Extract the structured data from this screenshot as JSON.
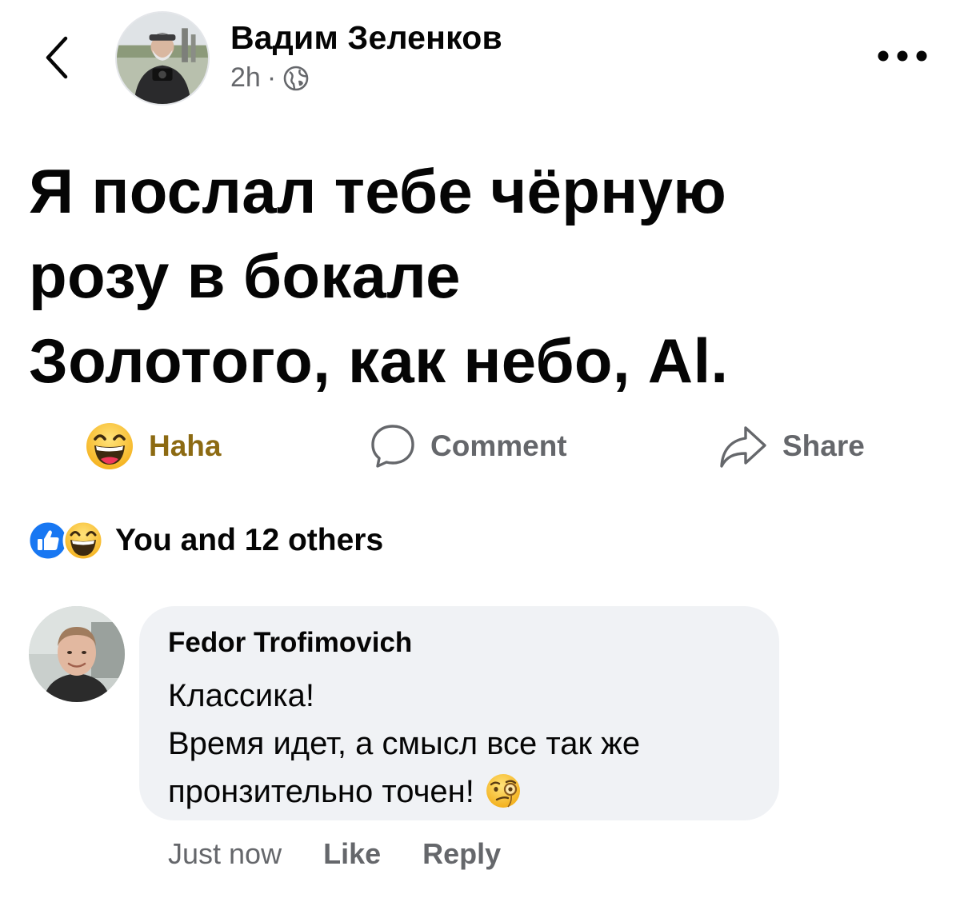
{
  "header": {
    "back_icon": "chevron-left-icon",
    "author_name": "Вадим Зеленков",
    "timestamp": "2h",
    "separator": "·",
    "audience_icon": "globe-icon",
    "more_icon": "more-horizontal-icon"
  },
  "post": {
    "lines": [
      "Я послал тебе чёрную",
      "розу в бокале",
      "Золотого, как небо, Аl."
    ]
  },
  "actions": {
    "reaction_label": "Haha",
    "reaction_icon": "haha-emoji-icon",
    "comment_label": "Comment",
    "comment_icon": "comment-bubble-icon",
    "share_label": "Share",
    "share_icon": "share-arrow-icon"
  },
  "reactions": {
    "icons": [
      "like-reaction-icon",
      "haha-reaction-icon"
    ],
    "summary": "You and 12 others"
  },
  "comment": {
    "author": "Fedor Trofimovich",
    "lines": [
      "Классика!",
      "Время идет, а смысл все так же",
      "пронзительно точен!"
    ],
    "emoji_icon": "face-with-monocle-icon",
    "time": "Just now",
    "like_label": "Like",
    "reply_label": "Reply"
  },
  "colors": {
    "text_primary": "#050505",
    "text_secondary": "#65676b",
    "haha_label": "#8c6a12",
    "like_blue": "#1877f2",
    "bubble_bg": "#f0f2f5"
  }
}
